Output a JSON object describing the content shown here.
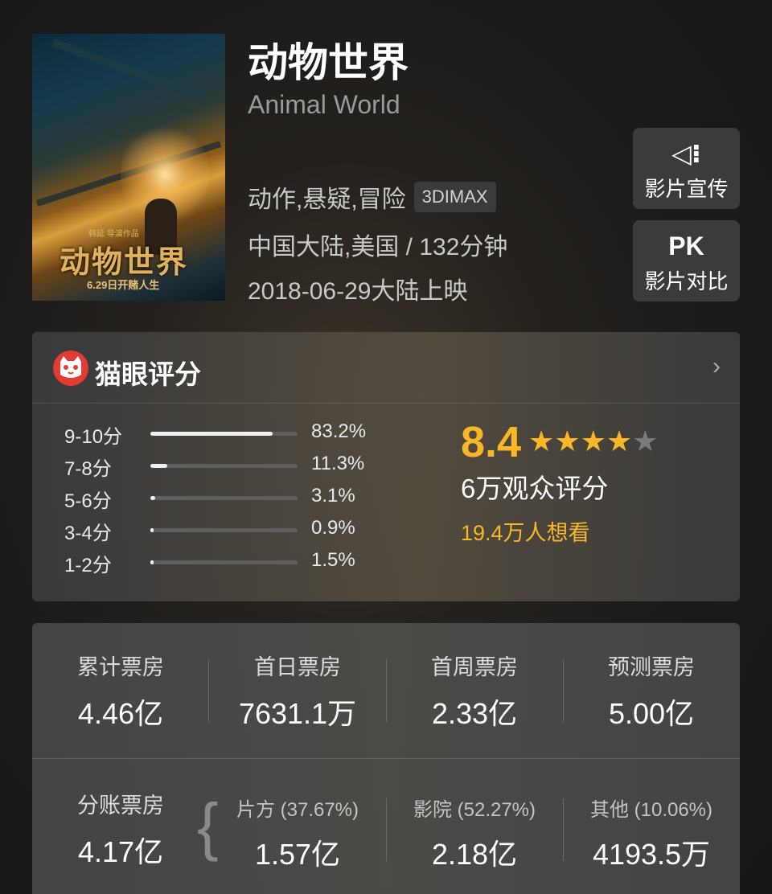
{
  "movie": {
    "title": "动物世界",
    "subtitle": "Animal World",
    "genre": "动作,悬疑,冒险",
    "format_badge": "3DIMAX",
    "region_duration": "中国大陆,美国 / 132分钟",
    "release": "2018-06-29大陆上映",
    "poster": {
      "title_text": "动物世界",
      "date_text": "6.29日开赌人生",
      "tag_text": "韩延 导演作品"
    }
  },
  "side_buttons": {
    "promo": {
      "icon": "speaker-icon",
      "icon_glyph": "◁⁝",
      "label": "影片宣传"
    },
    "compare": {
      "icon": "pk-icon",
      "icon_glyph": "PK",
      "label": "影片对比"
    }
  },
  "rating": {
    "header": "猫眼评分",
    "score": "8.4",
    "stars_filled": 4,
    "stars_total": 5,
    "audience_count": "6万观众评分",
    "want_to_see": "19.4万人想看",
    "distribution": [
      {
        "label": "9-10分",
        "pct": "83.2%",
        "value": 83.2
      },
      {
        "label": "7-8分",
        "pct": "11.3%",
        "value": 11.3
      },
      {
        "label": "5-6分",
        "pct": "3.1%",
        "value": 3.1
      },
      {
        "label": "3-4分",
        "pct": "0.9%",
        "value": 0.9
      },
      {
        "label": "1-2分",
        "pct": "1.5%",
        "value": 1.5
      }
    ]
  },
  "box_office": {
    "top": [
      {
        "label": "累计票房",
        "value": "4.46亿"
      },
      {
        "label": "首日票房",
        "value": "7631.1万"
      },
      {
        "label": "首周票房",
        "value": "2.33亿"
      },
      {
        "label": "预测票房",
        "value": "5.00亿"
      }
    ],
    "split": {
      "label": "分账票房",
      "value": "4.17亿"
    },
    "parts": [
      {
        "label": "片方 (37.67%)",
        "value": "1.57亿"
      },
      {
        "label": "影院 (52.27%)",
        "value": "2.18亿"
      },
      {
        "label": "其他 (10.06%)",
        "value": "4193.5万"
      }
    ]
  },
  "colors": {
    "accent": "#f9b727",
    "maoyan_red": "#e23b33"
  }
}
